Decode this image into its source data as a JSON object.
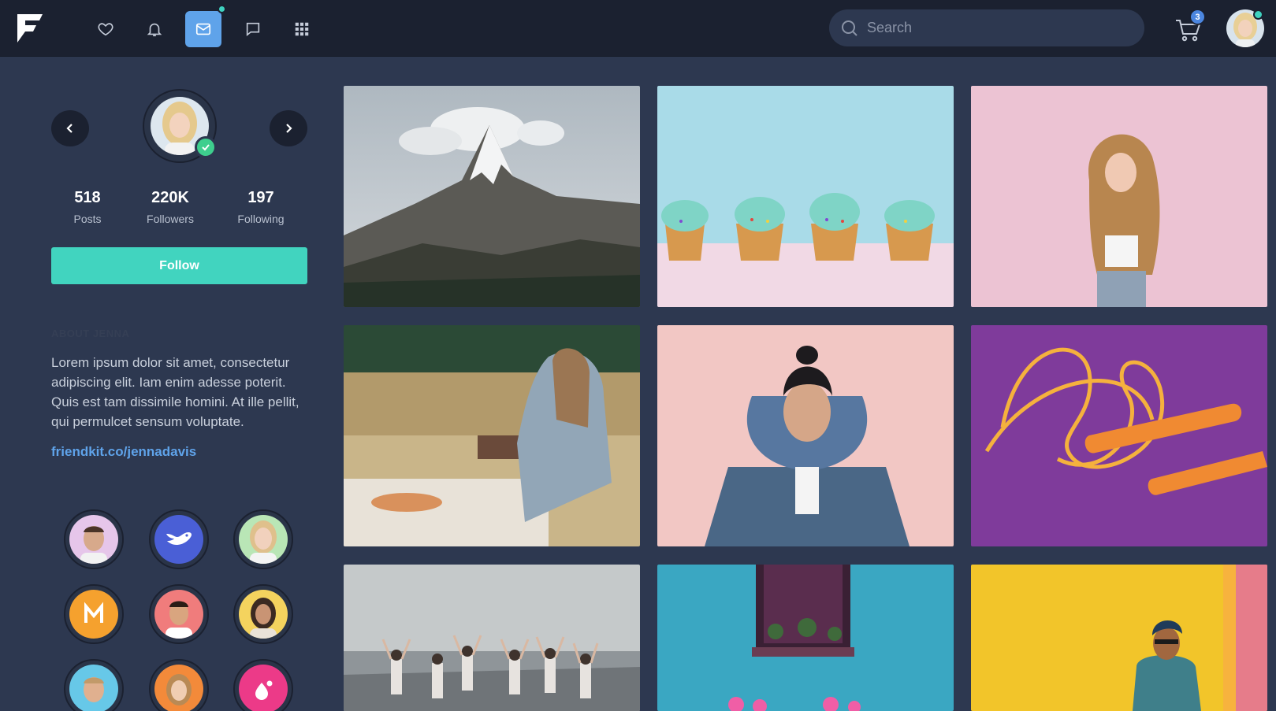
{
  "nav": {
    "logo_icon": "friendkit-logo",
    "icons": [
      "heart-icon",
      "bell-icon",
      "mail-icon",
      "chat-icon",
      "apps-grid-icon"
    ],
    "active_icon": "mail-icon",
    "search_placeholder": "Search",
    "cart_count": "3",
    "accent": "#5fa3ea"
  },
  "profile": {
    "stats": [
      {
        "value": "518",
        "label": "Posts"
      },
      {
        "value": "220K",
        "label": "Followers"
      },
      {
        "value": "197",
        "label": "Following"
      }
    ],
    "follow_label": "Follow",
    "about_title": "ABOUT JENNA",
    "about_text": "Lorem ipsum dolor sit amet, consectetur adipiscing elit. Iam enim adesse poterit. Quis est tam dissimile homini. At ille pellit, qui permulcet sensum voluptate.",
    "link": "friendkit.co/jennadavis",
    "follow_color": "#41d4bf"
  },
  "friends": [
    {
      "kind": "person"
    },
    {
      "kind": "brand-dove"
    },
    {
      "kind": "person"
    },
    {
      "kind": "brand-m"
    },
    {
      "kind": "person"
    },
    {
      "kind": "person"
    },
    {
      "kind": "person"
    },
    {
      "kind": "person"
    },
    {
      "kind": "brand-drop"
    }
  ],
  "photos": [
    "mountain",
    "cupcakes",
    "woman-pink",
    "picnic",
    "woman-denim",
    "jump-rope",
    "yoga-beach",
    "blue-window",
    "man-yellow-wall"
  ]
}
